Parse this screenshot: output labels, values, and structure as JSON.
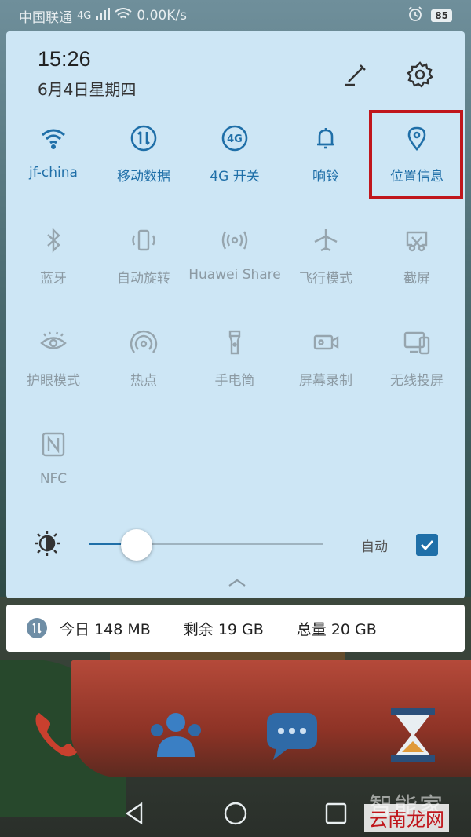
{
  "status_bar": {
    "carrier": "中国联通",
    "network_type": "4G",
    "speed": "0.00K/s",
    "battery": "85"
  },
  "header": {
    "time": "15:26",
    "date": "6月4日星期四"
  },
  "tiles_row1": [
    {
      "label": "jf-china",
      "icon": "wifi-icon",
      "state": "on"
    },
    {
      "label": "移动数据",
      "icon": "mobile-data-icon",
      "state": "on"
    },
    {
      "label": "4G 开关",
      "icon": "4g-icon",
      "state": "on"
    },
    {
      "label": "响铃",
      "icon": "bell-icon",
      "state": "on"
    },
    {
      "label": "位置信息",
      "icon": "location-pin-icon",
      "state": "on"
    }
  ],
  "tiles_row2": [
    {
      "label": "蓝牙",
      "icon": "bluetooth-icon",
      "state": "off"
    },
    {
      "label": "自动旋转",
      "icon": "rotate-icon",
      "state": "off"
    },
    {
      "label": "Huawei Share",
      "icon": "share-icon",
      "state": "off"
    },
    {
      "label": "飞行模式",
      "icon": "airplane-icon",
      "state": "off"
    },
    {
      "label": "截屏",
      "icon": "screenshot-icon",
      "state": "off"
    }
  ],
  "tiles_row3": [
    {
      "label": "护眼模式",
      "icon": "eye-icon",
      "state": "off"
    },
    {
      "label": "热点",
      "icon": "hotspot-icon",
      "state": "off"
    },
    {
      "label": "手电筒",
      "icon": "flashlight-icon",
      "state": "off"
    },
    {
      "label": "屏幕录制",
      "icon": "screen-record-icon",
      "state": "off"
    },
    {
      "label": "无线投屏",
      "icon": "cast-icon",
      "state": "off"
    }
  ],
  "tiles_row4": [
    {
      "label": "NFC",
      "icon": "nfc-icon",
      "state": "off"
    }
  ],
  "brightness": {
    "level": 0.2,
    "auto_label": "自动",
    "auto_checked": true
  },
  "data_usage": {
    "today": "今日 148 MB",
    "remaining": "剩余 19 GB",
    "total": "总量 20 GB"
  },
  "watermark": {
    "line1": "智能家",
    "line2": "云南龙网"
  },
  "colors": {
    "panel_bg": "#cde6f5",
    "accent": "#1f6fa8",
    "inactive": "#96a5ae",
    "highlight": "#c0161c"
  }
}
